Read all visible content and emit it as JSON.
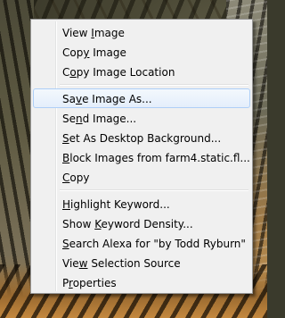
{
  "menu": {
    "groups": [
      {
        "items": [
          {
            "pre": "View ",
            "key": "I",
            "post": "mage"
          },
          {
            "pre": "Cop",
            "key": "y",
            "post": " Image"
          },
          {
            "pre": "C",
            "key": "o",
            "post": "py Image Location"
          }
        ]
      },
      {
        "items": [
          {
            "pre": "Sa",
            "key": "v",
            "post": "e Image As...",
            "highlighted": true
          },
          {
            "pre": "Se",
            "key": "n",
            "post": "d Image..."
          },
          {
            "pre": "",
            "key": "S",
            "post": "et As Desktop Background..."
          },
          {
            "pre": "",
            "key": "B",
            "post": "lock Images from farm4.static.fl..."
          },
          {
            "pre": "",
            "key": "C",
            "post": "opy"
          }
        ]
      },
      {
        "items": [
          {
            "pre": "",
            "key": "H",
            "post": "ighlight Keyword..."
          },
          {
            "pre": "Show ",
            "key": "K",
            "post": "eyword Density..."
          },
          {
            "pre": "",
            "key": "S",
            "post": "earch Alexa for \"by Todd Ryburn\""
          },
          {
            "pre": "Vie",
            "key": "w",
            "post": " Selection Source"
          },
          {
            "pre": "P",
            "key": "r",
            "post": "operties"
          }
        ]
      }
    ]
  }
}
